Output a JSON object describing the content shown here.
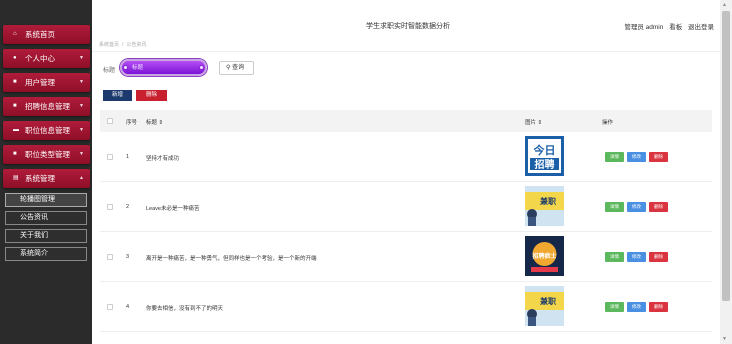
{
  "header": {
    "title": "学生求职实时智能数据分析",
    "user": "管理员 admin",
    "link_board": "看板",
    "link_logout": "退出登录"
  },
  "breadcrumb": [
    "系统首页",
    "公告资讯"
  ],
  "sidebar": {
    "items": [
      {
        "label": "系统首页",
        "icon": "home-icon",
        "chevron": ""
      },
      {
        "label": "个人中心",
        "icon": "user-icon",
        "chevron": "▼"
      },
      {
        "label": "用户管理",
        "icon": "grid-icon",
        "chevron": "▼"
      },
      {
        "label": "招聘信息管理",
        "icon": "grid-icon",
        "chevron": "▼"
      },
      {
        "label": "职位信息管理",
        "icon": "briefcase-icon",
        "chevron": "▼"
      },
      {
        "label": "职位类型管理",
        "icon": "grid-icon",
        "chevron": "▼"
      },
      {
        "label": "系统管理",
        "icon": "doc-icon",
        "chevron": "▲"
      }
    ],
    "sub_items": [
      "轮播图管理",
      "公告资讯",
      "关于我们",
      "系统简介"
    ]
  },
  "search": {
    "label": "标题",
    "placeholder": "标题",
    "button": "查询"
  },
  "actions": {
    "add": "新增",
    "delete": "删除"
  },
  "table": {
    "headers": {
      "index": "序号",
      "title": "标题",
      "image": "图片",
      "ops": "操作"
    },
    "rows": [
      {
        "index": "1",
        "title": "坚持才有成功"
      },
      {
        "index": "2",
        "title": "Leave未必是一种痛苦"
      },
      {
        "index": "3",
        "title": "离开是一种痛苦，是一种勇气，但同样也是一个考验，是一个新的开端"
      },
      {
        "index": "4",
        "title": "你要去相信，没有到不了的明天"
      }
    ],
    "op_labels": {
      "detail": "详情",
      "edit": "修改",
      "delete": "删除"
    }
  },
  "thumb_text": {
    "jinri": "今日",
    "zhaopin": "招聘",
    "jianzhi": "兼职",
    "zhaopin_kuang": "招聘疯士"
  },
  "colors": {
    "sidebar_bg": "#2b2b2b",
    "sidebar_item": "#a5173a",
    "search_purple": "#8a2bd2",
    "btn_navy": "#1d3a6e",
    "btn_red": "#c8202f",
    "op_green": "#5cb85c",
    "op_blue": "#4a90e2",
    "op_red": "#d9343f"
  }
}
